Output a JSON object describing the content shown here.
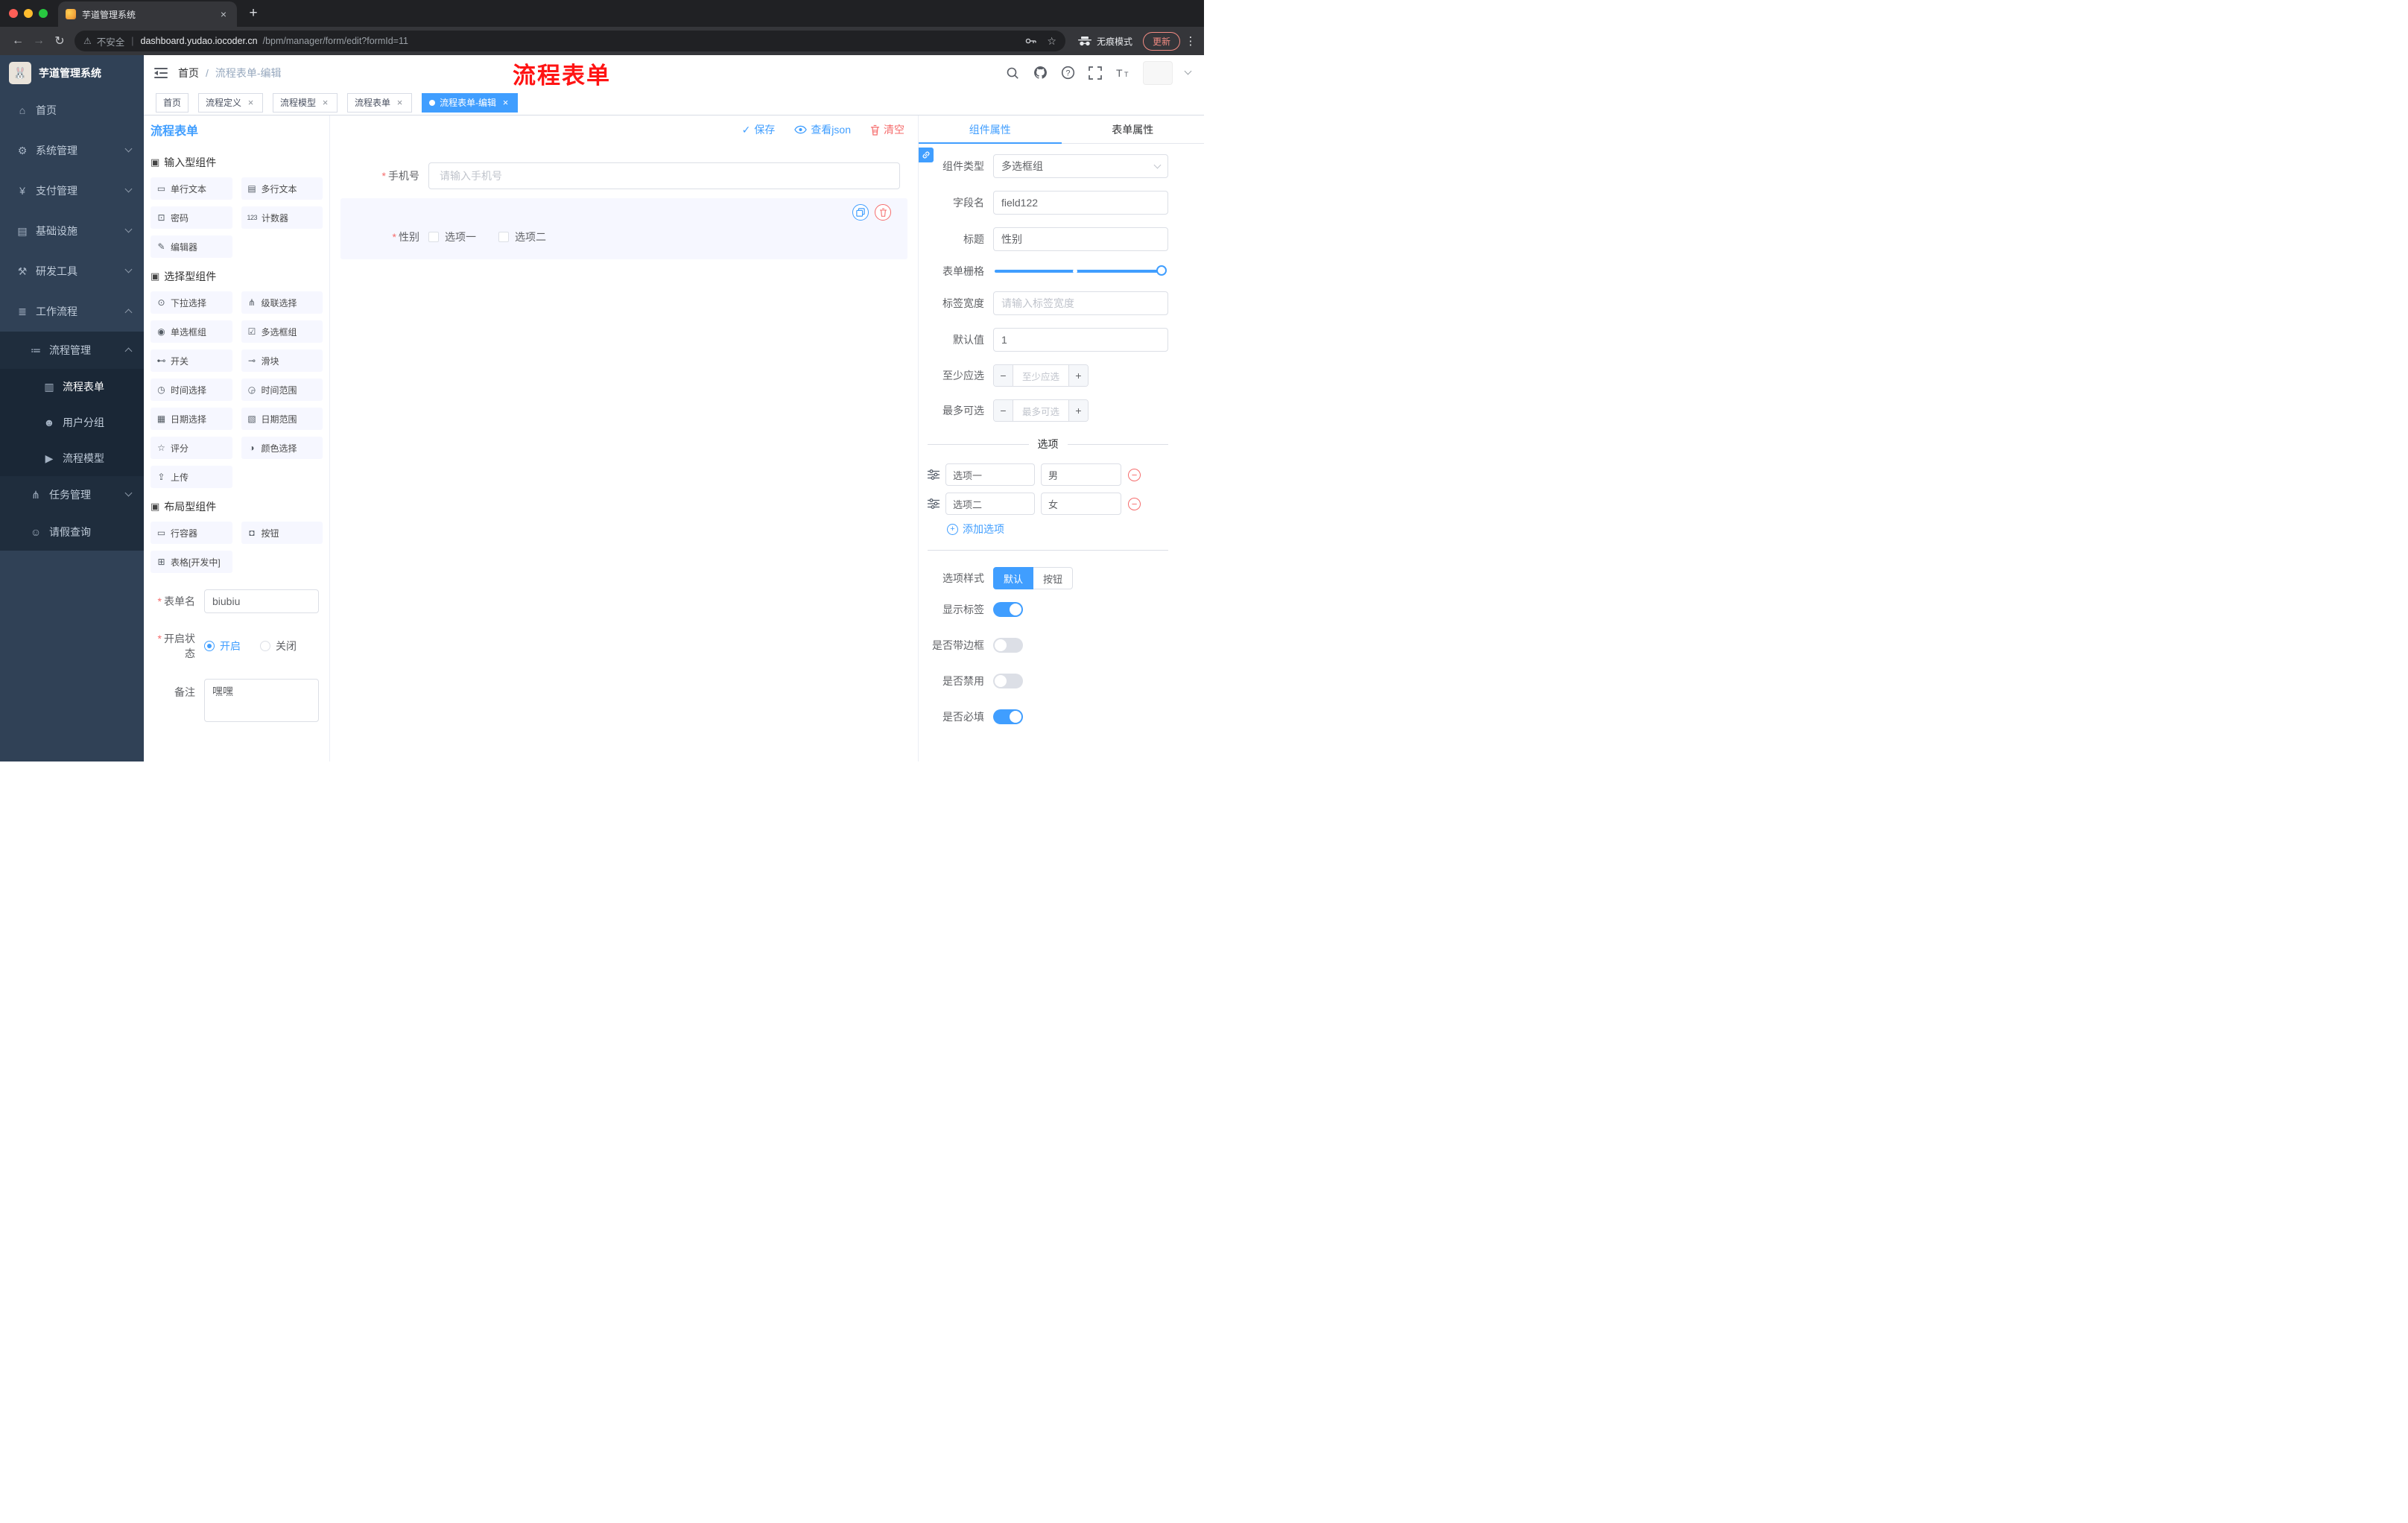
{
  "colors": {
    "primary": "#409eff",
    "danger": "#f56c6c",
    "sidebar_bg": "#304156",
    "annotation": "#ff1414"
  },
  "browser": {
    "tab_title": "芋道管理系统",
    "security_label": "不安全",
    "url_host": "dashboard.yudao.iocoder.cn",
    "url_path": "/bpm/manager/form/edit?formId=11",
    "incognito_label": "无痕模式",
    "update_label": "更新"
  },
  "sidebar": {
    "app_title": "芋道管理系统",
    "items": [
      {
        "label": "首页",
        "icon": "⌂"
      },
      {
        "label": "系统管理",
        "icon": "⚙"
      },
      {
        "label": "支付管理",
        "icon": "¥"
      },
      {
        "label": "基础设施",
        "icon": "▤"
      },
      {
        "label": "研发工具",
        "icon": "⚒"
      },
      {
        "label": "工作流程",
        "icon": "≣"
      },
      {
        "label": "流程管理",
        "icon": "≔"
      },
      {
        "label": "流程表单",
        "icon": "▥",
        "active": true
      },
      {
        "label": "用户分组",
        "icon": "☻"
      },
      {
        "label": "流程模型",
        "icon": "▶"
      },
      {
        "label": "任务管理",
        "icon": "⋔"
      },
      {
        "label": "请假查询",
        "icon": "☺"
      }
    ]
  },
  "header": {
    "breadcrumb_home": "首页",
    "breadcrumb_current": "流程表单-编辑"
  },
  "annotation": "流程表单",
  "tags": [
    {
      "label": "首页",
      "closable": false,
      "active": false
    },
    {
      "label": "流程定义",
      "closable": true,
      "active": false
    },
    {
      "label": "流程模型",
      "closable": true,
      "active": false
    },
    {
      "label": "流程表单",
      "closable": true,
      "active": false
    },
    {
      "label": "流程表单-编辑",
      "closable": true,
      "active": true
    }
  ],
  "designer": {
    "panel_title": "流程表单",
    "actions": {
      "save": "保存",
      "view_json": "查看json",
      "clear": "清空"
    },
    "palette": {
      "sections": [
        {
          "title": "输入型组件",
          "icon": "▣",
          "items": [
            {
              "label": "单行文本",
              "icon": "▭"
            },
            {
              "label": "多行文本",
              "icon": "▤"
            },
            {
              "label": "密码",
              "icon": "⊡"
            },
            {
              "label": "计数器",
              "icon": "123"
            },
            {
              "label": "编辑器",
              "icon": "✎"
            }
          ]
        },
        {
          "title": "选择型组件",
          "icon": "▣",
          "items": [
            {
              "label": "下拉选择",
              "icon": "⊙"
            },
            {
              "label": "级联选择",
              "icon": "⋔"
            },
            {
              "label": "单选框组",
              "icon": "◉"
            },
            {
              "label": "多选框组",
              "icon": "☑"
            },
            {
              "label": "开关",
              "icon": "⊷"
            },
            {
              "label": "滑块",
              "icon": "⊸"
            },
            {
              "label": "时间选择",
              "icon": "◷"
            },
            {
              "label": "时间范围",
              "icon": "◶"
            },
            {
              "label": "日期选择",
              "icon": "▦"
            },
            {
              "label": "日期范围",
              "icon": "▧"
            },
            {
              "label": "评分",
              "icon": "☆"
            },
            {
              "label": "颜色选择",
              "icon": "◑"
            },
            {
              "label": "上传",
              "icon": "⇪"
            }
          ]
        },
        {
          "title": "布局型组件",
          "icon": "▣",
          "items": [
            {
              "label": "行容器",
              "icon": "▭"
            },
            {
              "label": "按钮",
              "icon": "◘"
            },
            {
              "label": "表格[开发中]",
              "icon": "⊞"
            }
          ]
        }
      ],
      "form": {
        "name_label": "表单名",
        "name_value": "biubiu",
        "status_label": "开启状态",
        "status_on": "开启",
        "status_off": "关闭",
        "remark_label": "备注",
        "remark_value": "嘿嘿"
      }
    },
    "canvas": {
      "phone": {
        "label": "手机号",
        "placeholder": "请输入手机号"
      },
      "gender": {
        "label": "性别",
        "options": [
          "选项一",
          "选项二"
        ]
      }
    },
    "props": {
      "tab_component": "组件属性",
      "tab_form": "表单属性",
      "rows": {
        "type_label": "组件类型",
        "type_value": "多选框组",
        "field_label": "字段名",
        "field_value": "field122",
        "title_label": "标题",
        "title_value": "性别",
        "grid_label": "表单栅格",
        "label_width_label": "标签宽度",
        "label_width_placeholder": "请输入标签宽度",
        "default_label": "默认值",
        "default_value": "1",
        "min_label": "至少应选",
        "min_placeholder": "至少应选",
        "max_label": "最多可选",
        "max_placeholder": "最多可选"
      },
      "options_divider": "选项",
      "options": [
        {
          "name": "选项一",
          "value": "男"
        },
        {
          "name": "选项二",
          "value": "女"
        }
      ],
      "add_option": "添加选项",
      "style_label": "选项样式",
      "style_default": "默认",
      "style_button": "按钮",
      "toggles": [
        {
          "label": "显示标签",
          "on": true
        },
        {
          "label": "是否带边框",
          "on": false
        },
        {
          "label": "是否禁用",
          "on": false
        },
        {
          "label": "是否必填",
          "on": true
        }
      ]
    }
  }
}
